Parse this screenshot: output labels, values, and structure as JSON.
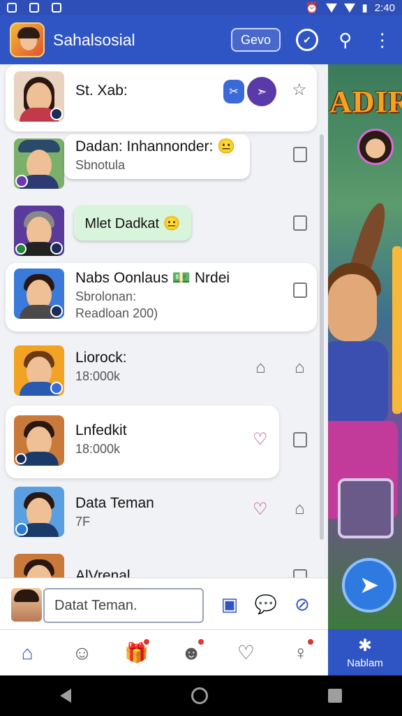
{
  "status_bar": {
    "time": "2:40"
  },
  "header": {
    "app_title": "Sahalsosial",
    "action_label": "Gevo"
  },
  "game": {
    "title": "ADIRK"
  },
  "conversations": [
    {
      "name": "St. Xab:",
      "sub": "",
      "bubble": ""
    },
    {
      "name": "Dadan: Inhannonder: 😐",
      "sub": "Sbnotula",
      "bubble": ""
    },
    {
      "name": "",
      "sub": "",
      "bubble": "Mlet Dadkat 😐"
    },
    {
      "name": "Nabs Oonlaus 💵 Nrdei",
      "sub": "Sbrolonan:",
      "sub2": "Readloan 200)"
    },
    {
      "name": "Liorock:",
      "sub": "18:000k"
    },
    {
      "name": "Lnfedkit",
      "sub": "18:000k"
    },
    {
      "name": "Data Teman",
      "sub": "7F"
    },
    {
      "name": "AlVrenal",
      "sub": ""
    }
  ],
  "composer": {
    "placeholder": "Datat Teman."
  },
  "side_tab": {
    "label": "Nablam"
  },
  "colors": {
    "primary": "#2f55c4",
    "bubble_green": "#d8f5dc"
  }
}
